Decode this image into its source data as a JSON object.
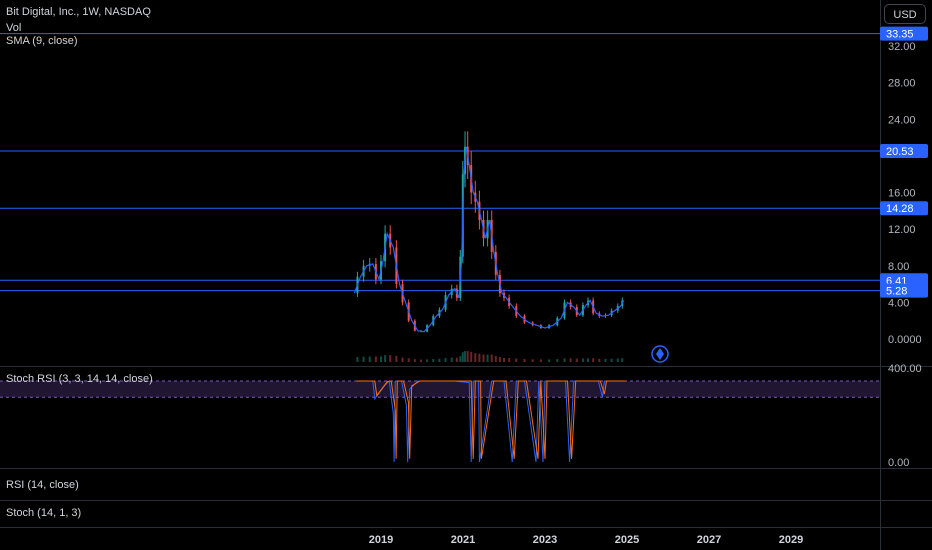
{
  "header": {
    "title": "Bit Digital, Inc., 1W, NASDAQ",
    "vol_label": "Vol",
    "sma_label": "SMA (9, close)",
    "currency": "USD"
  },
  "indicators": {
    "stoch_rsi": "Stoch RSI (3, 3, 14, 14, close)",
    "rsi": "RSI (14, close)",
    "stoch": "Stoch (14, 1, 3)"
  },
  "colors": {
    "background": "#000000",
    "hline": "#2962ff",
    "price_tag": "#2962ff",
    "candle_up": "#26a69a",
    "candle_down": "#ef5350",
    "sma": "#2962ff",
    "stoch_k": "#2962ff",
    "stoch_d": "#ff6d00",
    "band": "#7e57c2"
  },
  "chart_data": {
    "type": "line",
    "title": "Bit Digital, Inc., 1W, NASDAQ",
    "x_ticks": [
      "2019",
      "2021",
      "2023",
      "2025",
      "2027",
      "2029"
    ],
    "y_ticks": [
      "32.00",
      "28.00",
      "24.00",
      "16.00",
      "12.00",
      "8.00",
      "4.00",
      "0.0000"
    ],
    "ylim": [
      0,
      33.5
    ],
    "horizontal_lines": [
      33.35,
      20.53,
      14.28,
      6.41,
      5.28
    ],
    "price_labels": [
      "33.35",
      "20.53",
      "14.28",
      "6.41",
      "5.28"
    ],
    "series": [
      {
        "name": "SMA (9, close)",
        "x": [
          2018.35,
          2018.5,
          2018.65,
          2018.8,
          2018.95,
          2019.05,
          2019.15,
          2019.3,
          2019.45,
          2019.6,
          2019.75,
          2019.9,
          2020.05,
          2020.2,
          2020.35,
          2020.5,
          2020.65,
          2020.8,
          2020.9,
          2020.97,
          2021.02,
          2021.08,
          2021.15,
          2021.25,
          2021.35,
          2021.45,
          2021.55,
          2021.65,
          2021.75,
          2021.85,
          2021.95,
          2022.05,
          2022.2,
          2022.4,
          2022.6,
          2022.8,
          2023.0,
          2023.2,
          2023.4,
          2023.55,
          2023.7,
          2023.85,
          2024.0,
          2024.1,
          2024.25,
          2024.4,
          2024.55,
          2024.7,
          2024.85,
          2024.92
        ],
        "values": [
          5.0,
          6.8,
          8.0,
          8.2,
          6.5,
          8.5,
          11.5,
          10.0,
          6.0,
          4.0,
          2.0,
          0.9,
          0.8,
          1.5,
          2.5,
          3.2,
          4.8,
          5.5,
          4.5,
          9.0,
          18.0,
          21.0,
          19.0,
          16.0,
          15.0,
          13.0,
          11.0,
          13.0,
          9.5,
          7.0,
          5.0,
          4.5,
          3.6,
          2.5,
          1.8,
          1.5,
          1.2,
          1.5,
          2.3,
          4.0,
          3.5,
          2.6,
          3.7,
          4.2,
          2.8,
          2.5,
          2.6,
          3.1,
          3.6,
          4.2
        ]
      },
      {
        "name": "Stoch RSI (3, 3, 14, 14, close)",
        "x": [
          2018.35,
          2018.8,
          2018.85,
          2019.1,
          2019.2,
          2019.3,
          2019.32,
          2019.35,
          2019.5,
          2019.62,
          2019.65,
          2019.7,
          2019.9,
          2020.3,
          2020.8,
          2021.15,
          2021.2,
          2021.25,
          2021.38,
          2021.4,
          2021.7,
          2022.0,
          2022.2,
          2022.3,
          2022.35,
          2022.5,
          2022.78,
          2022.85,
          2022.95,
          2023.0,
          2023.5,
          2023.6,
          2023.7,
          2024.0,
          2024.3,
          2024.4,
          2024.45,
          2024.7,
          2024.92
        ],
        "values": [
          100,
          100,
          78,
          95,
          100,
          60,
          0,
          100,
          100,
          70,
          0,
          90,
          100,
          100,
          100,
          98,
          0,
          100,
          100,
          0,
          100,
          100,
          0,
          100,
          100,
          100,
          0,
          100,
          0,
          100,
          100,
          0,
          100,
          100,
          100,
          80,
          100,
          100,
          100
        ]
      }
    ],
    "stoch_rsi_ticks": [
      "400.00",
      "0.00"
    ]
  }
}
